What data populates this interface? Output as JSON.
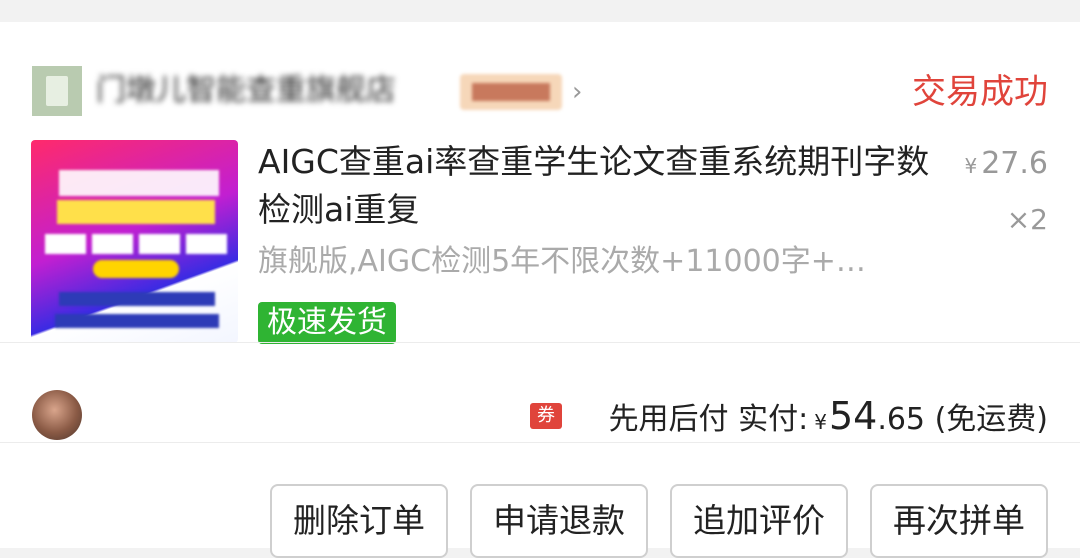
{
  "order": {
    "shop": {
      "name": "门墩儿智能查重旗舰店",
      "badge": "品牌店"
    },
    "status": "交易成功",
    "item": {
      "title": "AIGC查重ai率查重学生论文查重系统期刊字数检测ai重复",
      "spec": "旗舰版,AIGC检测5年不限次数+11000字+…",
      "tag": "极速发货",
      "price_symbol": "¥",
      "price": "27.6",
      "quantity": "×2"
    },
    "summary": {
      "coupon_icon_label": "券",
      "pay_later": "先用后付",
      "paid_label": "实付:",
      "currency": "¥",
      "amount_int": "54",
      "amount_dec": ".65",
      "shipping_note": "(免运费)"
    },
    "actions": [
      "删除订单",
      "申请退款",
      "追加评价",
      "再次拼单"
    ]
  },
  "colors": {
    "status": "#e0443b",
    "tag_bg": "#2fb433",
    "coupon_bg": "#e0443b"
  },
  "icons": {
    "shop_chevron": "chevron-right-icon",
    "coupon": "coupon-icon"
  }
}
